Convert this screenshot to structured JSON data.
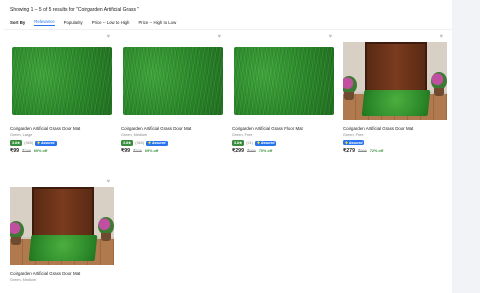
{
  "results_text": "Showing 1 – 5 of 5 results for \"Coirgarden Artificial Grass \"",
  "sort": {
    "label": "Sort By",
    "options": [
      "Relevance",
      "Popularity",
      "Price -- Low to High",
      "Price -- High to Low"
    ],
    "active": "Relevance"
  },
  "colors": {
    "accent": "#2874f0",
    "rating_green": "#388e3c",
    "discount_green": "#388e3c"
  },
  "products": [
    {
      "title": "Coirgarden Artificial Grass Door Mat",
      "variant": "Green, Large",
      "rating": "3.8★",
      "reviews": "(365)",
      "assured": "Assured",
      "price": "₹99",
      "mrp": "₹249",
      "discount": "60% off",
      "image": "green-grass-mat",
      "wishlist_icon": "heart-icon"
    },
    {
      "title": "Coirgarden Artificial Grass Door Mat",
      "variant": "Green, Medium",
      "rating": "3.8★",
      "reviews": "(365)",
      "assured": "Assured",
      "price": "₹99",
      "mrp": "₹326",
      "discount": "69% off",
      "image": "green-grass-mat",
      "wishlist_icon": "heart-icon"
    },
    {
      "title": "Coirgarden Artificial Grass Floor Mat",
      "variant": "Green, Free",
      "rating": "3.8★",
      "reviews": "(21)",
      "assured": "Assured",
      "price": "₹299",
      "mrp": "₹999",
      "discount": "70% off",
      "image": "green-grass-mat",
      "wishlist_icon": "heart-icon"
    },
    {
      "title": "Coirgarden Artificial Grass Door Mat",
      "variant": "Green, Free",
      "rating": "",
      "reviews": "",
      "assured": "Assured",
      "price": "₹279",
      "mrp": "₹999",
      "discount": "72% off",
      "image": "doorstep-grass-mat",
      "wishlist_icon": "heart-icon"
    },
    {
      "title": "Coirgarden Artificial Grass Door Mat",
      "variant": "Green, Medium",
      "image": "doorstep-grass-mat",
      "wishlist_icon": "heart-icon"
    }
  ]
}
